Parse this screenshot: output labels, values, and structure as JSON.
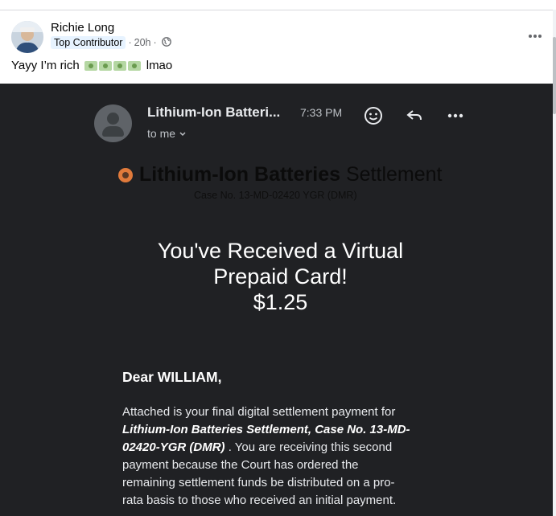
{
  "post": {
    "author": "Richie Long",
    "badge": "Top Contributor",
    "time": "20h",
    "separator": "·",
    "audience_icon": "globe-icon",
    "text_before": "Yayy I’m rich",
    "emoji": "money-with-wings-emoji",
    "emoji_count": 4,
    "text_after": "lmao",
    "more_icon": "more-horizontal-icon"
  },
  "email": {
    "sender": "Lithium-Ion Batteri...",
    "time": "7:33 PM",
    "recipient": "to me",
    "icons": [
      "smile-icon",
      "reply-icon",
      "more-horizontal-icon"
    ],
    "brand_bold": "Lithium-Ion Batteries",
    "brand_light": "Settlement",
    "case_number": "Case No. 13-MD-02420 YGR (DMR)",
    "headline_line1": "You've Received a Virtual",
    "headline_line2": "Prepaid Card!",
    "amount": "$1.25",
    "greeting": "Dear WILLIAM,",
    "body_lines": [
      "Attached is your final digital settlement payment for",
      "Lithium-Ion Batteries Settlement, Case No. 13-MD-",
      "02420-YGR (DMR)",
      ". You are receiving this second",
      "payment because the Court has ordered the",
      "remaining settlement funds be distributed on a pro-",
      "rata basis to those who received an initial payment."
    ]
  },
  "colors": {
    "email_background": "#202124",
    "badge_background": "#e7f3ff",
    "logo": "#e07a3b"
  }
}
